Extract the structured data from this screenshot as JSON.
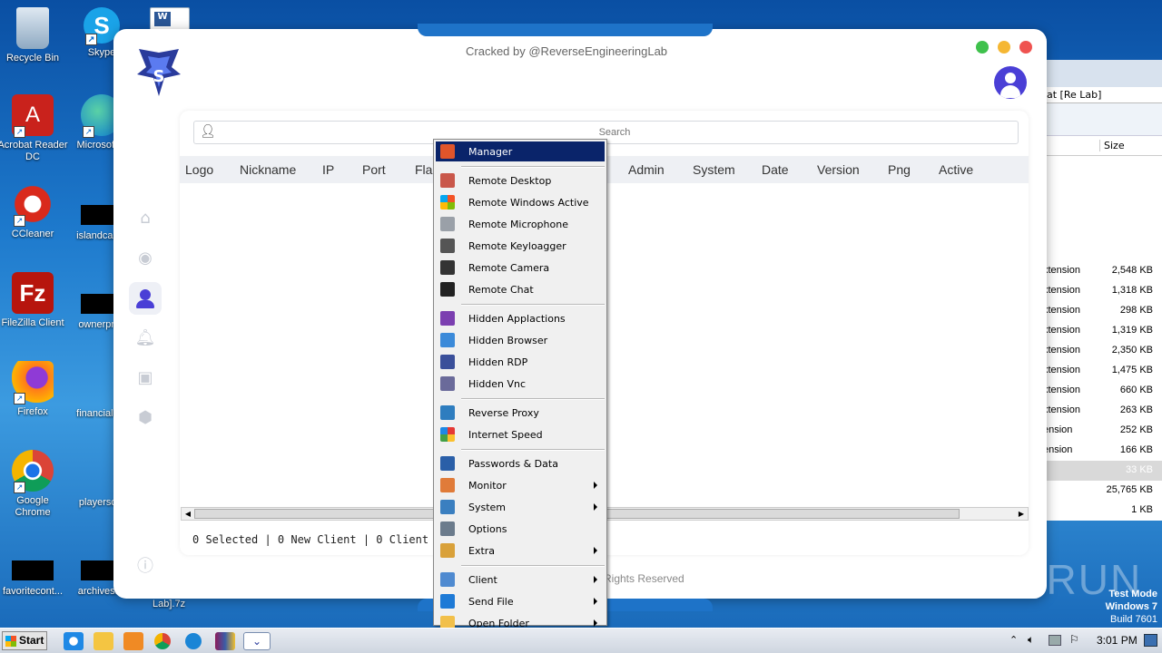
{
  "desktop": {
    "icons": [
      {
        "label": "Recycle Bin"
      },
      {
        "label": "Skype"
      },
      {
        "label": "Acrobat Reader DC"
      },
      {
        "label": "Microsoft E"
      },
      {
        "label": "CCleaner"
      },
      {
        "label": "islandcard.j"
      },
      {
        "label": "FileZilla Client"
      },
      {
        "label": "ownerpres"
      },
      {
        "label": "Firefox"
      },
      {
        "label": "financialhot"
      },
      {
        "label": "Google Chrome"
      },
      {
        "label": "playersdie"
      },
      {
        "label": "favoritecont..."
      },
      {
        "label": "archivesflo"
      },
      {
        "label": "Lab].7z"
      }
    ],
    "watermark": "ANY RUN",
    "test_mode": {
      "line1": "Test Mode",
      "line2": "Windows 7",
      "line3": "Build 7601"
    }
  },
  "explorer": {
    "title_fragment": "at [Re Lab]",
    "col_size": "Size",
    "rows": [
      {
        "type": "xtension",
        "size": "2,548 KB"
      },
      {
        "type": "xtension",
        "size": "1,318 KB"
      },
      {
        "type": "xtension",
        "size": "298 KB"
      },
      {
        "type": "xtension",
        "size": "1,319 KB"
      },
      {
        "type": "xtension",
        "size": "2,350 KB"
      },
      {
        "type": "xtension",
        "size": "1,475 KB"
      },
      {
        "type": "xtension",
        "size": "660 KB"
      },
      {
        "type": "xtension",
        "size": "263 KB"
      },
      {
        "type": "ension",
        "size": "252 KB"
      },
      {
        "type": "ension",
        "size": "166 KB"
      },
      {
        "type": "",
        "size": "33 KB"
      },
      {
        "type": "",
        "size": "25,765 KB"
      },
      {
        "type": "",
        "size": "1 KB"
      }
    ]
  },
  "app": {
    "header_text": "Cracked by @ReverseEngineeringLab",
    "search_placeholder": "Search",
    "columns": [
      "Logo",
      "Nickname",
      "IP",
      "Port",
      "Flag",
      "Admin",
      "System",
      "Date",
      "Version",
      "Png",
      "Active"
    ],
    "status": "0 Selected | 0 New Client | 0 Client",
    "footer": "Rights Reserved",
    "colors": {
      "green": "#3fc14c",
      "yellow": "#f5b733",
      "red": "#ef5350",
      "accent": "#4a3fd6"
    }
  },
  "menu": {
    "groups": [
      [
        {
          "label": "Manager",
          "icon": "manager-icon",
          "selected": true
        }
      ],
      [
        {
          "label": "Remote Desktop",
          "icon": "desktop-icon"
        },
        {
          "label": "Remote Windows Active",
          "icon": "windows-icon"
        },
        {
          "label": "Remote Microphone",
          "icon": "microphone-icon"
        },
        {
          "label": "Remote Keyloagger",
          "icon": "keyboard-icon"
        },
        {
          "label": "Remote Camera",
          "icon": "camera-icon"
        },
        {
          "label": "Remote Chat",
          "icon": "chat-icon"
        }
      ],
      [
        {
          "label": "Hidden Applactions",
          "icon": "apps-icon"
        },
        {
          "label": "Hidden Browser",
          "icon": "globe-icon"
        },
        {
          "label": "Hidden RDP",
          "icon": "rdp-icon"
        },
        {
          "label": "Hidden Vnc",
          "icon": "vnc-icon"
        }
      ],
      [
        {
          "label": "Reverse Proxy",
          "icon": "proxy-icon"
        },
        {
          "label": "Internet Speed",
          "icon": "speed-icon"
        }
      ],
      [
        {
          "label": "Passwords & Data",
          "icon": "keys-icon"
        },
        {
          "label": "Monitor",
          "icon": "monitor-icon",
          "sub": true
        },
        {
          "label": "System",
          "icon": "system-icon",
          "sub": true
        },
        {
          "label": "Options",
          "icon": "wrench-icon"
        },
        {
          "label": "Extra",
          "icon": "extra-icon",
          "sub": true
        }
      ],
      [
        {
          "label": "Client",
          "icon": "user-icon",
          "sub": true
        },
        {
          "label": "Send File",
          "icon": "upload-icon",
          "sub": true
        },
        {
          "label": "Open Folder",
          "icon": "folder-icon",
          "sub": true
        }
      ]
    ]
  },
  "taskbar": {
    "start": "Start",
    "clock": "3:01 PM"
  }
}
